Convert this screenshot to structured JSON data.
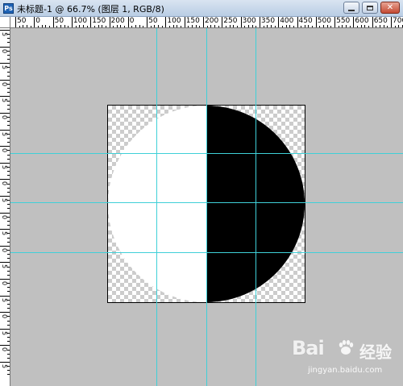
{
  "window": {
    "title": "未标题-1 @ 66.7% (图层 1, RGB/8)",
    "app_icon": "photoshop-document-icon",
    "buttons": {
      "minimize": "minimize-icon",
      "maximize": "maximize-icon",
      "close": "close-icon",
      "close_glyph": "✕"
    }
  },
  "rulers": {
    "horizontal_labels": [
      "50",
      "0",
      "50",
      "100",
      "150",
      "200",
      "0",
      "50",
      "100",
      "150",
      "200",
      "250",
      "300",
      "350",
      "400",
      "450",
      "500",
      "550",
      "600",
      "650",
      "700"
    ],
    "vertical_labels": [
      "5",
      "0",
      "5",
      "0",
      "5",
      "0",
      "5",
      "0",
      "5",
      "0",
      "5",
      "0",
      "5",
      "0",
      "5",
      "0",
      "5",
      "0",
      "5",
      "0",
      "5"
    ]
  },
  "canvas": {
    "background_color": "#c0c0c0",
    "guide_color": "#3fd0d8",
    "layer": {
      "left_half_color": "#ffffff",
      "right_half_color": "#000000",
      "transparency": "checkerboard"
    }
  },
  "watermark": {
    "brand": "Bai",
    "brand_suffix": "经验",
    "url": "jingyan.baidu.com"
  }
}
